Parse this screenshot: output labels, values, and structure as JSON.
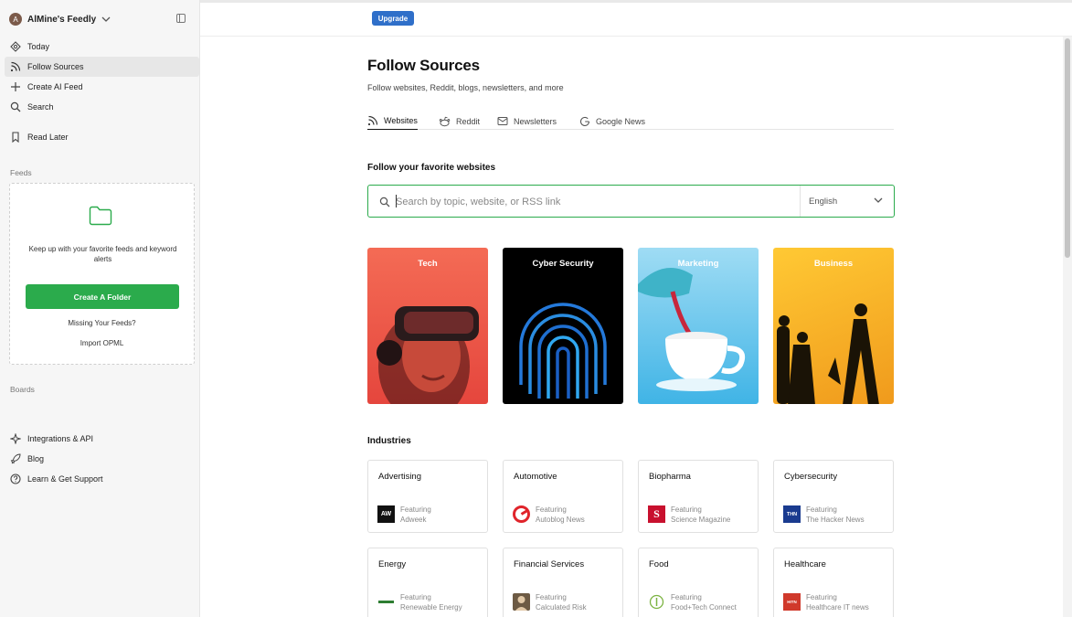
{
  "sidebar": {
    "avatar_letter": "A",
    "workspace_title": "AlMine's Feedly",
    "nav": [
      {
        "label": "Today",
        "icon": "today-icon"
      },
      {
        "label": "Follow Sources",
        "icon": "rss-icon"
      },
      {
        "label": "Create AI Feed",
        "icon": "plus-icon"
      },
      {
        "label": "Search",
        "icon": "search-icon"
      },
      {
        "label": "Read Later",
        "icon": "bookmark-icon"
      }
    ],
    "feeds_label": "Feeds",
    "feeds_box": {
      "text": "Keep up with your favorite feeds and keyword alerts",
      "button": "Create A Folder",
      "missing": "Missing Your Feeds?",
      "import": "Import OPML"
    },
    "boards_label": "Boards",
    "bottom": [
      {
        "label": "Integrations & API",
        "icon": "sparkle-icon"
      },
      {
        "label": "Blog",
        "icon": "rocket-icon"
      },
      {
        "label": "Learn & Get Support",
        "icon": "help-icon"
      }
    ]
  },
  "topbar": {
    "upgrade": "Upgrade"
  },
  "main": {
    "title": "Follow Sources",
    "subtitle": "Follow websites, Reddit, blogs, newsletters, and more",
    "tabs": [
      {
        "label": "Websites",
        "icon": "rss-icon"
      },
      {
        "label": "Reddit",
        "icon": "reddit-icon"
      },
      {
        "label": "Newsletters",
        "icon": "mail-icon"
      },
      {
        "label": "Google News",
        "icon": "google-icon"
      }
    ],
    "section_title": "Follow your favorite websites",
    "search": {
      "placeholder": "Search by topic, website, or RSS link",
      "value": "",
      "language": "English"
    },
    "categories": [
      {
        "label": "Tech",
        "color": "#f06a55"
      },
      {
        "label": "Cyber Security",
        "color": "#000000"
      },
      {
        "label": "Marketing",
        "color": "#7fd0ee"
      },
      {
        "label": "Business",
        "color": "#f7b42c"
      }
    ],
    "industries_title": "Industries",
    "industries": [
      {
        "name": "Advertising",
        "featuring": "Featuring",
        "source": "Adweek",
        "logo_text": "AW",
        "logo_color": "#111111"
      },
      {
        "name": "Automotive",
        "featuring": "Featuring",
        "source": "Autoblog News",
        "logo_text": "",
        "logo_color": "#e0242b"
      },
      {
        "name": "Biopharma",
        "featuring": "Featuring",
        "source": "Science Magazine",
        "logo_text": "S",
        "logo_color": "#c8102e"
      },
      {
        "name": "Cybersecurity",
        "featuring": "Featuring",
        "source": "The Hacker News",
        "logo_text": "THN",
        "logo_color": "#1a3b8f"
      },
      {
        "name": "Energy",
        "featuring": "Featuring",
        "source": "Renewable Energy",
        "logo_text": "",
        "logo_color": "#2e7d32"
      },
      {
        "name": "Financial Services",
        "featuring": "Featuring",
        "source": "Calculated Risk",
        "logo_text": "",
        "logo_color": "#6d5a44"
      },
      {
        "name": "Food",
        "featuring": "Featuring",
        "source": "Food+Tech Connect",
        "logo_text": "",
        "logo_color": "#7cb342"
      },
      {
        "name": "Healthcare",
        "featuring": "Featuring",
        "source": "Healthcare IT news",
        "logo_text": "HITN",
        "logo_color": "#d0392b"
      }
    ]
  }
}
